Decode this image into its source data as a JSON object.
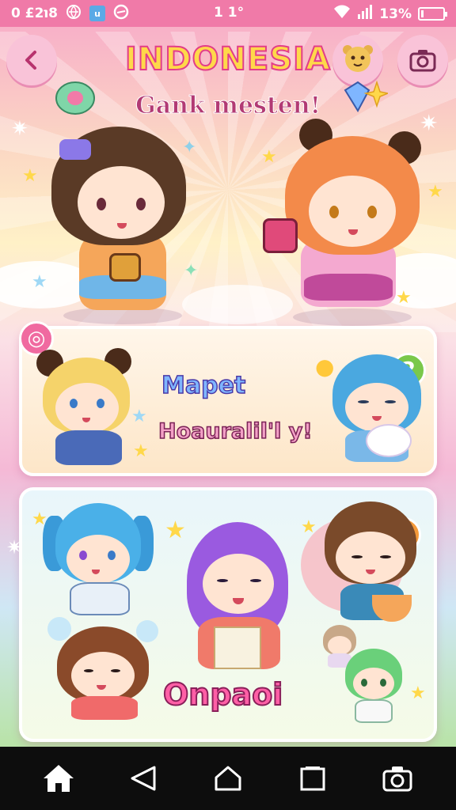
{
  "status_bar": {
    "left_text": "0 £2℩8",
    "center_text": "1 1°",
    "app_badge": "u",
    "battery_percent": "13%",
    "battery_level": 0.13,
    "background_color": "#f07aa8"
  },
  "header": {
    "title": "INDONESIA",
    "subtitle": "Gank mesten!",
    "back_icon": "chevron-left-icon",
    "camera_icon": "camera-icon"
  },
  "cards": {
    "card1": {
      "label_top": "Mapet",
      "label_bottom": "Hoauralil'l y!",
      "badge_top_left": "◎",
      "badge_top_right": "2"
    },
    "card2": {
      "label": "Onpaoi",
      "badge_top_right": "?"
    }
  },
  "nav": {
    "home_icon": "home-icon",
    "back_icon": "triangle-back-icon",
    "house_outline_icon": "home-outline-icon",
    "recents_icon": "square-recents-icon",
    "camera_icon": "camera-icon"
  },
  "colors": {
    "accent_pink": "#f07aa8",
    "title_yellow": "#ffd84a",
    "title_outline": "#e23d8a"
  }
}
